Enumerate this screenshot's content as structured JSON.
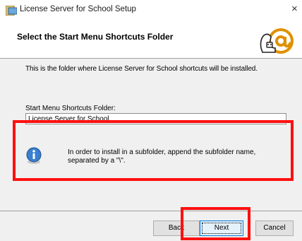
{
  "window": {
    "title": "License Server for School Setup",
    "close_label": "×"
  },
  "header": {
    "title": "Select the Start Menu Shortcuts Folder",
    "logo_icon": "setup-logo-at-sign-icon"
  },
  "main": {
    "description": "This is the folder where License Server for School shortcuts will be installed.",
    "folder_label": "Start Menu Shortcuts Folder:",
    "folder_value": "License Server for School",
    "info_icon": "info-icon",
    "info_text": "In order to install in a subfolder, append the subfolder name, separated by a \"\\\"."
  },
  "buttons": {
    "back_label": "Back",
    "next_label": "Next",
    "cancel_label": "Cancel"
  },
  "colors": {
    "annotation": "#ff1010",
    "accent": "#0078d7"
  }
}
